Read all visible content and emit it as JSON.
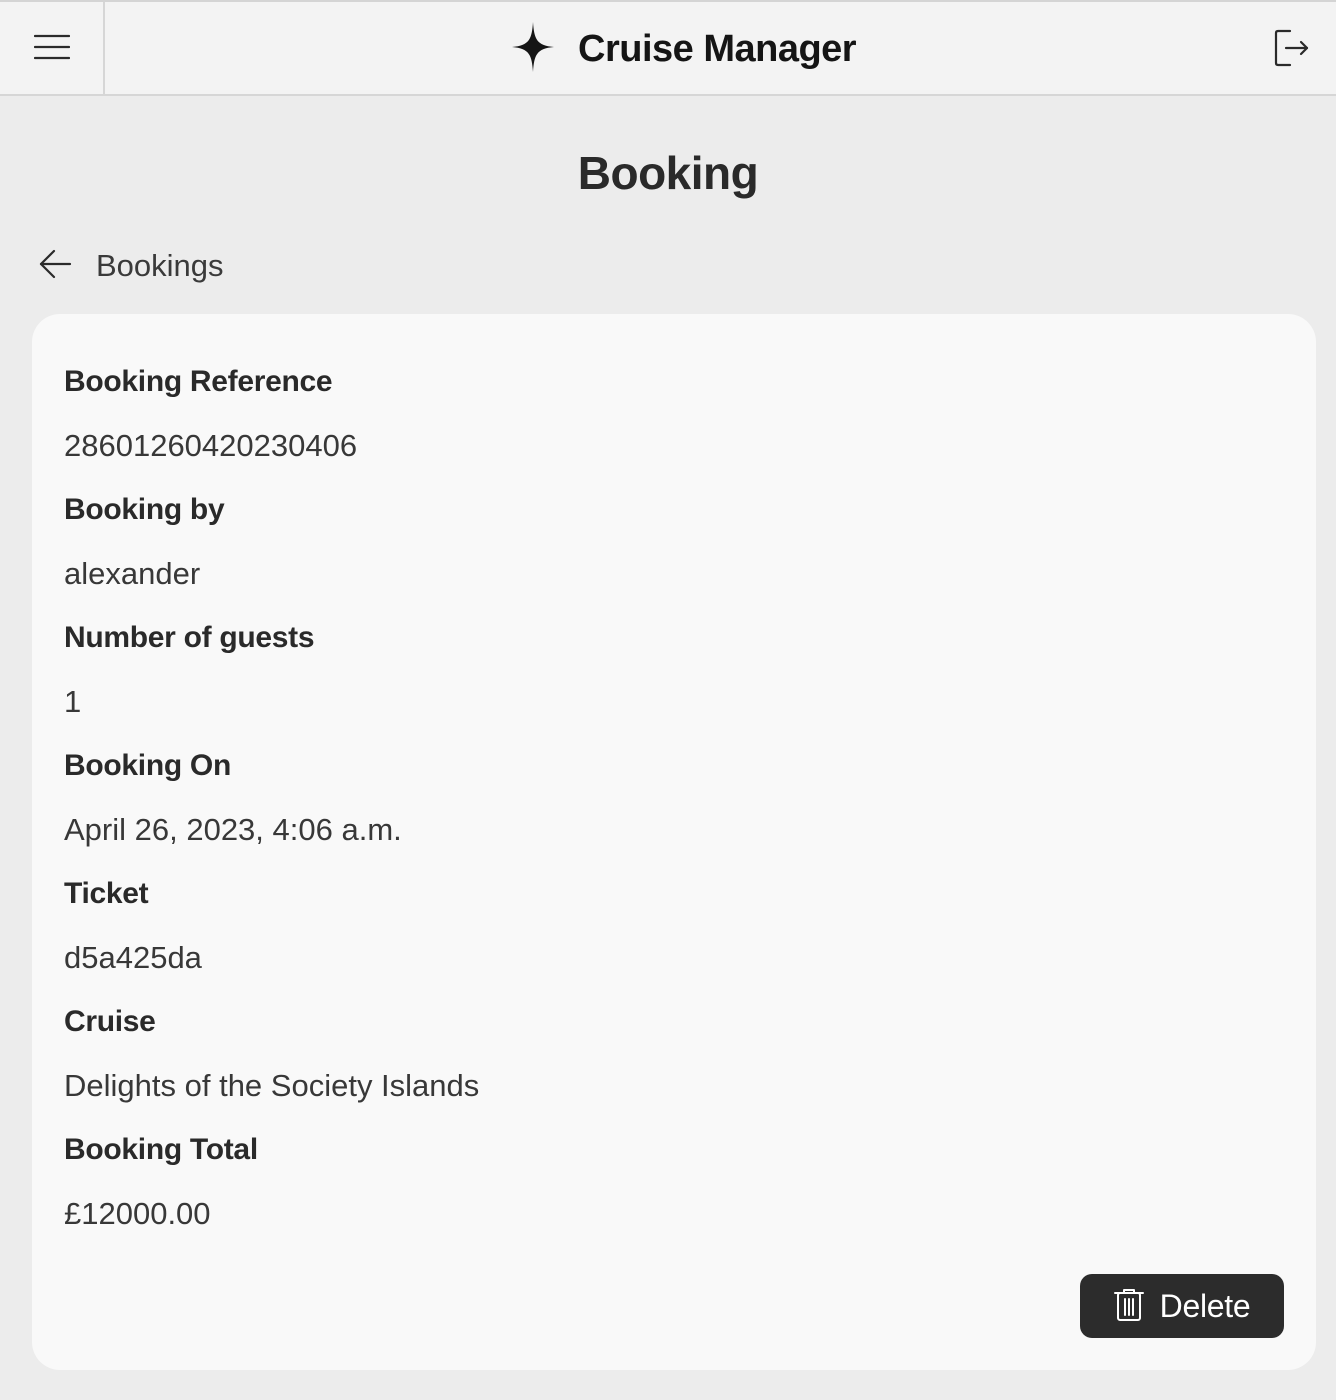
{
  "header": {
    "app_title": "Cruise Manager",
    "menu_icon": "hamburger-menu-icon",
    "logo_icon": "sparkle-star-icon",
    "logout_icon": "logout-icon"
  },
  "page": {
    "title": "Booking"
  },
  "breadcrumb": {
    "back_icon": "arrow-left-icon",
    "label": "Bookings"
  },
  "booking": {
    "fields": [
      {
        "label": "Booking Reference",
        "value": "28601260420230406"
      },
      {
        "label": "Booking by",
        "value": "alexander"
      },
      {
        "label": "Number of guests",
        "value": "1"
      },
      {
        "label": "Booking On",
        "value": "April 26, 2023, 4:06 a.m."
      },
      {
        "label": "Ticket",
        "value": "d5a425da"
      },
      {
        "label": "Cruise",
        "value": "Delights of the Society Islands"
      },
      {
        "label": "Booking Total",
        "value": "£12000.00"
      }
    ]
  },
  "actions": {
    "delete_label": "Delete",
    "delete_icon": "trash-icon"
  },
  "colors": {
    "background": "#ececec",
    "header": "#f3f3f3",
    "card": "#f9f9f9",
    "button": "#2c2c2c",
    "text": "#2a2a2a"
  }
}
